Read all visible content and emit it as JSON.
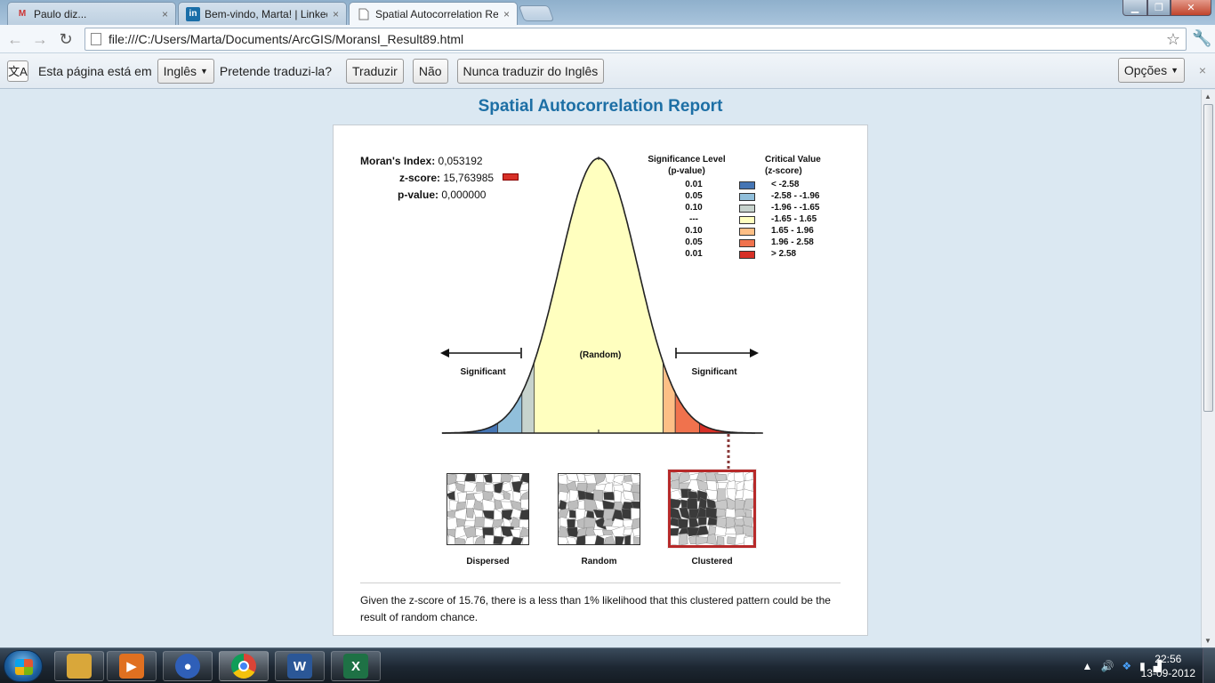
{
  "browser": {
    "tabs": [
      {
        "label": "Paulo diz...",
        "favicon": "gmail-icon",
        "active": false
      },
      {
        "label": "Bem-vindo, Marta! | Linked",
        "favicon": "linkedin-icon",
        "active": false
      },
      {
        "label": "Spatial Autocorrelation Rep",
        "favicon": "page-icon",
        "active": true
      }
    ],
    "tab_close": "×",
    "url": "file:///C:/Users/Marta/Documents/ArcGIS/MoransI_Result89.html"
  },
  "translate_bar": {
    "prefix": "Esta página está em",
    "language": "Inglês",
    "question": "Pretende traduzi-la?",
    "translate_label": "Traduzir",
    "no_label": "Não",
    "never_label": "Nunca traduzir do Inglês",
    "options_label": "Opções",
    "close": "×"
  },
  "report": {
    "title": "Spatial Autocorrelation Report",
    "stats": [
      {
        "label": "Moran's Index:",
        "value": "0,053192"
      },
      {
        "label": "z-score:",
        "value": "15,763985"
      },
      {
        "label": "p-value:",
        "value": "0,000000"
      }
    ],
    "zscore_color": "#d73027",
    "legend": {
      "sig_header_1": "Significance Level",
      "sig_header_2": "(p-value)",
      "crit_header_1": "Critical Value",
      "crit_header_2": "(z-score)",
      "rows": [
        {
          "p": "0.01",
          "z": "< -2.58",
          "color": "#4575b4"
        },
        {
          "p": "0.05",
          "z": "-2.58 - -1.96",
          "color": "#91bfdb"
        },
        {
          "p": "0.10",
          "z": "-1.96 - -1.65",
          "color": "#c7d3cd"
        },
        {
          "p": "---",
          "z": "-1.65 - 1.65",
          "color": "#ffffbf"
        },
        {
          "p": "0.10",
          "z": "1.65 - 1.96",
          "color": "#fdbf86"
        },
        {
          "p": "0.05",
          "z": "1.96 - 2.58",
          "color": "#f0724d"
        },
        {
          "p": "0.01",
          "z": "> 2.58",
          "color": "#d73027"
        }
      ]
    },
    "curve_labels": {
      "random": "(Random)",
      "significant_left": "Significant",
      "significant_right": "Significant"
    },
    "maps": [
      {
        "label": "Dispersed",
        "selected": false
      },
      {
        "label": "Random",
        "selected": false
      },
      {
        "label": "Clustered",
        "selected": true
      }
    ],
    "conclusion": "Given the z-score of 15.76, there is a less than 1% likelihood that this clustered pattern could be the result of random chance."
  },
  "taskbar": {
    "apps": [
      {
        "name": "windows-explorer",
        "glyph": "",
        "color": "#d9a73a"
      },
      {
        "name": "media-player",
        "glyph": "▶",
        "color": "#e07020"
      },
      {
        "name": "messenger",
        "glyph": "●",
        "color": "#2f5fb8"
      },
      {
        "name": "chrome",
        "glyph": "",
        "color": "#3a8f3a"
      },
      {
        "name": "word",
        "glyph": "W",
        "color": "#2b5797"
      },
      {
        "name": "excel",
        "glyph": "X",
        "color": "#1e7145"
      }
    ],
    "time": "22:56",
    "date": "13-09-2012"
  }
}
